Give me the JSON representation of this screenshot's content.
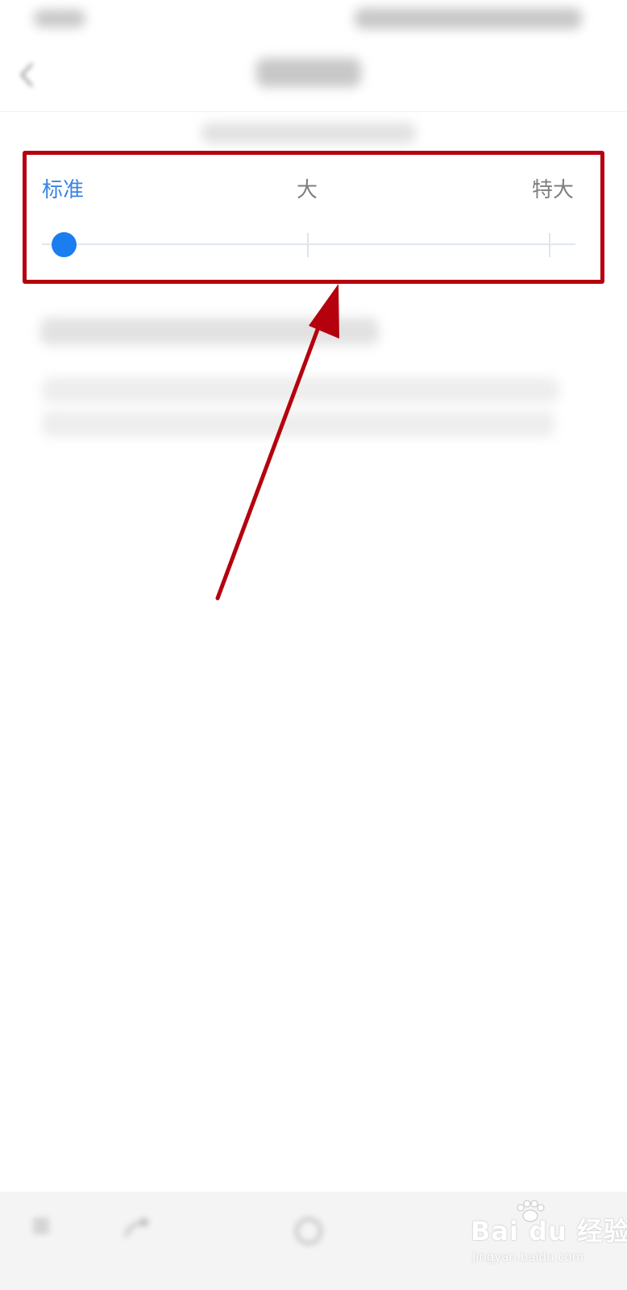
{
  "font_size_slider": {
    "options": [
      {
        "label": "标准",
        "active": true
      },
      {
        "label": "大",
        "active": false
      },
      {
        "label": "特大",
        "active": false
      }
    ],
    "selected_index": 0,
    "selected_label": "标准"
  },
  "colors": {
    "accent": "#1a7df0",
    "active_label": "#3a84e4",
    "inactive_label": "#7f7f7f",
    "annotation": "#b5000d",
    "bottom_bar": "#f4f4f4"
  },
  "icons": {
    "header": [
      "back-icon"
    ],
    "bottom_bar": [
      "menu-icon",
      "share-icon",
      "home-icon"
    ],
    "watermark": [
      "paw-icon"
    ]
  },
  "watermark": {
    "brand": "Bai du 经验",
    "url": "jingyan.baidu.com"
  }
}
